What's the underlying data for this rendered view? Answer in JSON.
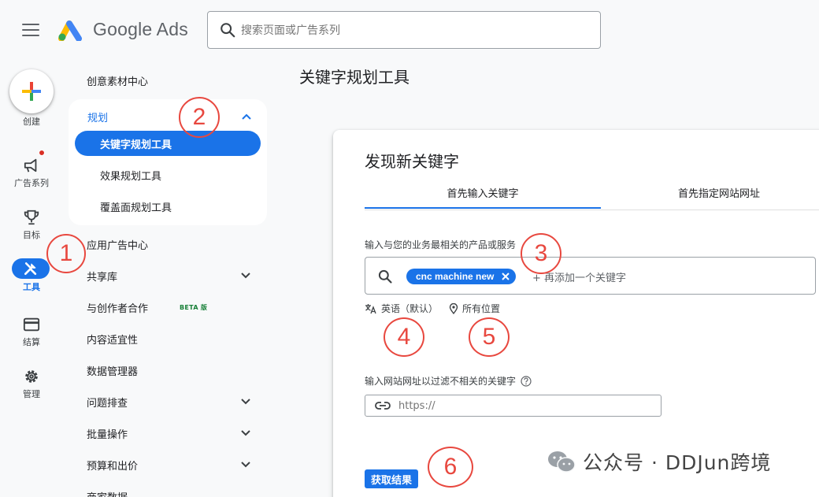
{
  "header": {
    "brand": "Google Ads",
    "search_placeholder": "搜索页面或广告系列"
  },
  "rail": {
    "create_label": "创建",
    "items": [
      {
        "label": "广告系列",
        "icon": "megaphone-icon"
      },
      {
        "label": "目标",
        "icon": "trophy-icon"
      },
      {
        "label": "工具",
        "icon": "tools-icon",
        "active": true
      },
      {
        "label": "结算",
        "icon": "credit-card-icon"
      },
      {
        "label": "管理",
        "icon": "gear-icon"
      }
    ]
  },
  "nav": {
    "top_item": "创意素材中心",
    "plan": {
      "label": "规划",
      "items": [
        "关键字规划工具",
        "效果规划工具",
        "覆盖面规划工具"
      ]
    },
    "items": [
      {
        "label": "应用广告中心"
      },
      {
        "label": "共享库",
        "expandable": true
      },
      {
        "label": "与创作者合作",
        "badge": "BETA 版"
      },
      {
        "label": "内容适宜性"
      },
      {
        "label": "数据管理器"
      },
      {
        "label": "问题排查",
        "expandable": true
      },
      {
        "label": "批量操作",
        "expandable": true
      },
      {
        "label": "预算和出价",
        "expandable": true
      },
      {
        "label": "商家数据"
      }
    ]
  },
  "main": {
    "page_title": "关键字规划工具",
    "card_title": "发现新关键字",
    "tabs": [
      "首先输入关键字",
      "首先指定网站网址"
    ],
    "keyword_hint": "输入与您的业务最相关的产品或服务",
    "keyword_chip": "cnc machine new",
    "keyword_placeholder": "+ 再添加一个关键字",
    "language": "英语（默认）",
    "location": "所有位置",
    "url_hint": "输入网站网址以过滤不相关的关键字",
    "url_placeholder": "https://",
    "submit_label": "获取结果"
  },
  "annotations": [
    "1",
    "2",
    "3",
    "4",
    "5",
    "6"
  ],
  "watermark": "公众号 · DDJun跨境",
  "colors": {
    "accent": "#1a73e8",
    "annotation": "#e8483f",
    "notification": "#d93025"
  }
}
